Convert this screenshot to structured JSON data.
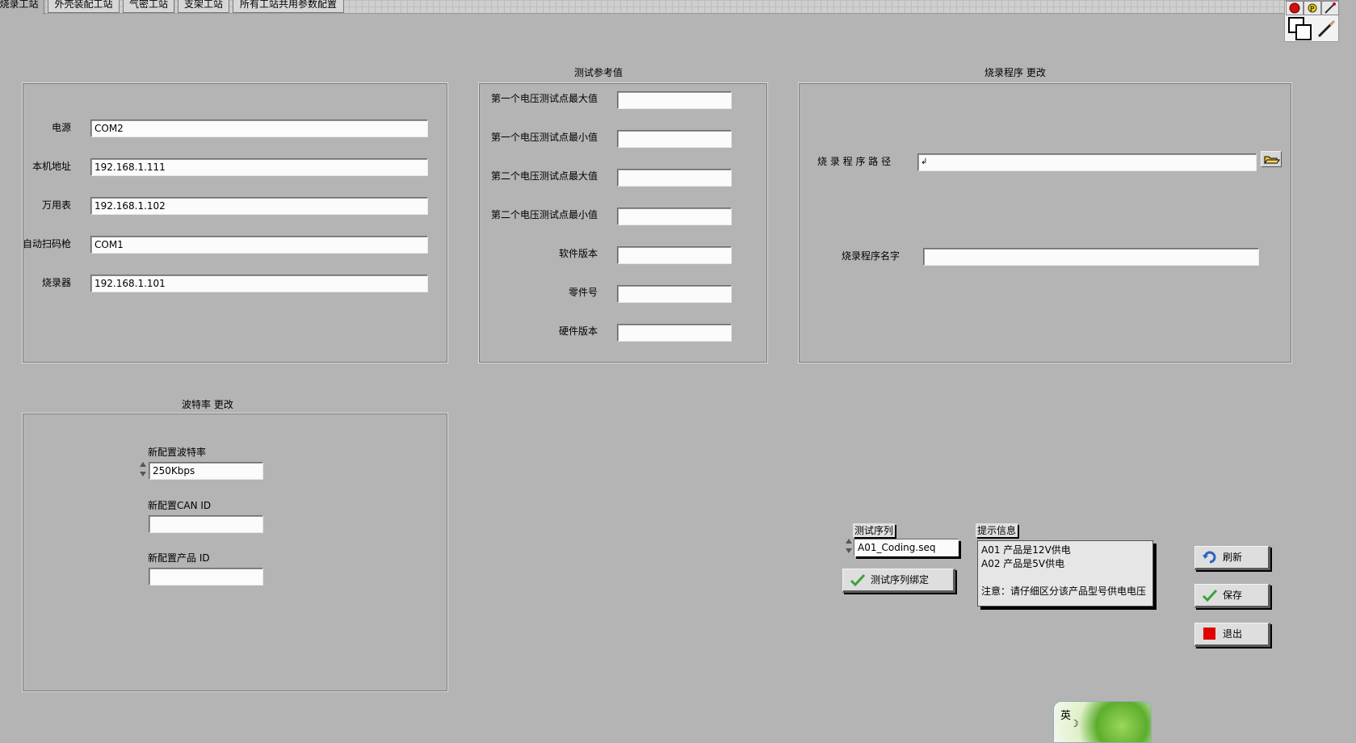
{
  "tabs": [
    "烧录工站",
    "外壳装配工站",
    "气密工站",
    "支架工站",
    "所有工站共用参数配置"
  ],
  "toolbar_icons": [
    "stop-icon",
    "probe-icon",
    "color-picker-icon",
    "layers-icon",
    "paintbrush-icon"
  ],
  "comm_panel": {
    "rows": [
      {
        "label": "电源",
        "value": "COM2"
      },
      {
        "label": "本机地址",
        "value": "192.168.1.111"
      },
      {
        "label": "万用表",
        "value": "192.168.1.102"
      },
      {
        "label": "自动扫码枪",
        "value": "COM1"
      },
      {
        "label": "烧录器",
        "value": "192.168.1.101"
      }
    ]
  },
  "ref_panel": {
    "title": "测试参考值",
    "rows": [
      {
        "label": "第一个电压测试点最大值",
        "value": ""
      },
      {
        "label": "第一个电压测试点最小值",
        "value": ""
      },
      {
        "label": "第二个电压测试点最大值",
        "value": ""
      },
      {
        "label": "第二个电压测试点最小值",
        "value": ""
      },
      {
        "label": "软件版本",
        "value": ""
      },
      {
        "label": "零件号",
        "value": ""
      },
      {
        "label": "硬件版本",
        "value": ""
      }
    ]
  },
  "burn_panel": {
    "title": "烧录程序 更改",
    "path_label": "烧 录 程 序 路 径",
    "path_value": "",
    "path_icon": "folder-open-icon",
    "name_label": "烧录程序名字",
    "name_value": ""
  },
  "baud_panel": {
    "title": "波特率 更改",
    "baud_label": "新配置波特率",
    "baud_value": "250Kbps",
    "canid_label": "新配置CAN ID",
    "canid_value": "",
    "pid_label": "新配置产品 ID",
    "pid_value": ""
  },
  "sequence": {
    "label": "测试序列",
    "value": "A01_Coding.seq",
    "bind_button": "测试序列绑定"
  },
  "hint": {
    "label": "提示信息",
    "lines": [
      "A01 产品是12V供电",
      "A02 产品是5V供电",
      "",
      "注意：请仔细区分该产品型号供电电压"
    ]
  },
  "buttons": {
    "refresh": "刷新",
    "save": "保存",
    "exit": "退出"
  },
  "ime": {
    "text": "英"
  },
  "colors": {
    "background": "#b4b4b4",
    "exit_icon": "#e00000",
    "check_icon": "#3aa33a"
  }
}
